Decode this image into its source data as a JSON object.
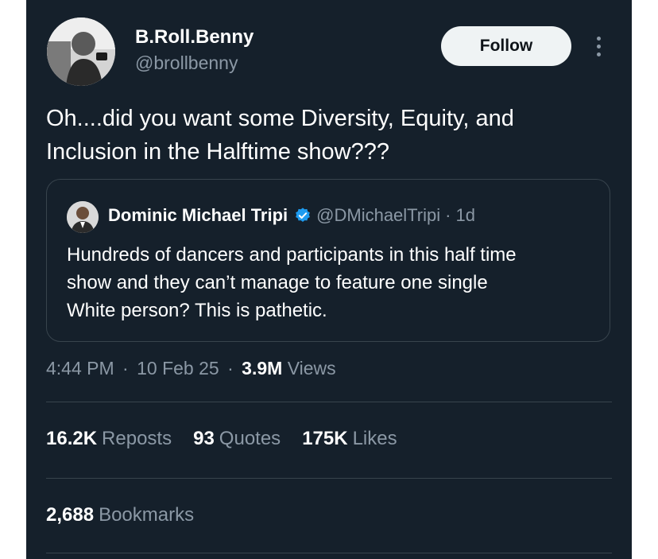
{
  "author": {
    "name": "B.Roll.Benny",
    "handle": "@brollbenny",
    "avatar_icon": "profile-photo-icon"
  },
  "actions": {
    "follow_label": "Follow",
    "more_icon": "more-vertical-icon"
  },
  "tweet": {
    "text_line1": "Oh....did you want some Diversity, Equity, and",
    "text_line2": "Inclusion in the Halftime show???"
  },
  "quoted": {
    "name": "Dominic Michael Tripi",
    "verified_icon": "verified-badge-icon",
    "handle": "@DMichaelTripi",
    "separator": "·",
    "age": "1d",
    "text_line1": "Hundreds of dancers and participants in this half time",
    "text_line2": "show and they can’t manage to feature one single",
    "text_line3": "White person? This is pathetic."
  },
  "meta": {
    "time": "4:44 PM",
    "date": "10 Feb 25",
    "separator": "·",
    "views_count": "3.9M",
    "views_label": "Views"
  },
  "stats": {
    "reposts_count": "16.2K",
    "reposts_label": "Reposts",
    "quotes_count": "93",
    "quotes_label": "Quotes",
    "likes_count": "175K",
    "likes_label": "Likes",
    "bookmarks_count": "2,688",
    "bookmarks_label": "Bookmarks"
  },
  "colors": {
    "background": "#15202b",
    "text_primary": "#e7e9ea",
    "text_secondary": "#8b98a5",
    "border": "#38444d",
    "verified": "#1d9bf0",
    "follow_bg": "#eff3f4"
  }
}
